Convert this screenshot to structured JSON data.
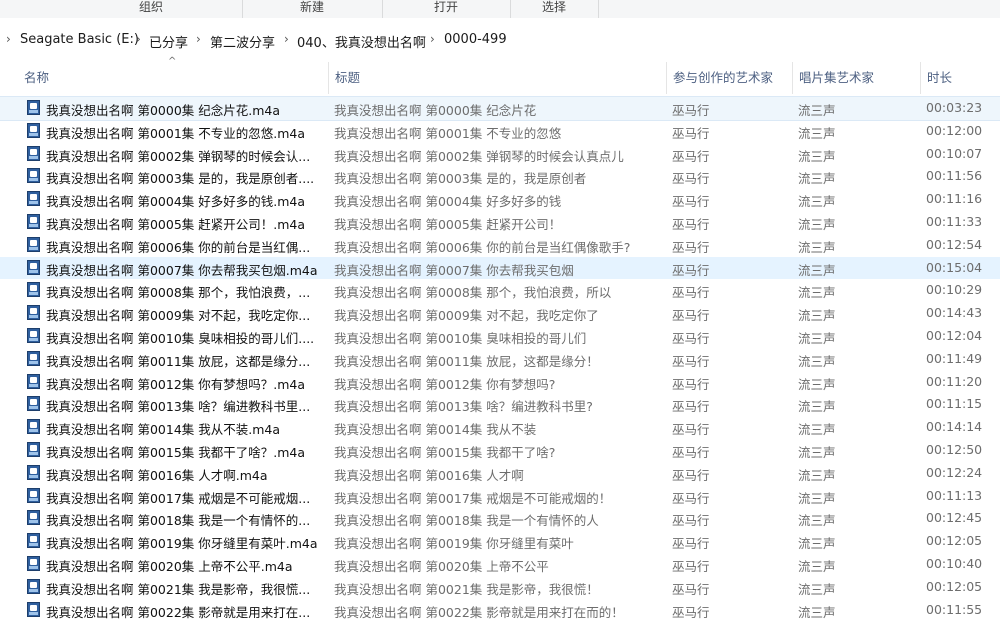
{
  "ribbon": {
    "groups": [
      "组织",
      "新建",
      "打开",
      "选择"
    ]
  },
  "breadcrumb": [
    "Seagate Basic (E:)",
    "已分享",
    "第二波分享",
    "040、我真没想出名啊",
    "0000-499"
  ],
  "columns": {
    "name": "名称",
    "title": "标题",
    "artist": "参与创作的艺术家",
    "album_artist": "唱片集艺术家",
    "duration": "时长"
  },
  "files": [
    {
      "name": "我真没想出名啊 第0000集 纪念片花.m4a",
      "title": "我真没想出名啊 第0000集 纪念片花",
      "artist": "巫马行",
      "album_artist": "流三声",
      "duration": "00:03:23"
    },
    {
      "name": "我真没想出名啊 第0001集 不专业的忽悠.m4a",
      "title": "我真没想出名啊 第0001集 不专业的忽悠",
      "artist": "巫马行",
      "album_artist": "流三声",
      "duration": "00:12:00"
    },
    {
      "name": "我真没想出名啊 第0002集 弹钢琴的时候会认...",
      "title": "我真没想出名啊 第0002集 弹钢琴的时候会认真点儿",
      "artist": "巫马行",
      "album_artist": "流三声",
      "duration": "00:10:07"
    },
    {
      "name": "我真没想出名啊 第0003集 是的，我是原创者....",
      "title": "我真没想出名啊 第0003集 是的，我是原创者",
      "artist": "巫马行",
      "album_artist": "流三声",
      "duration": "00:11:56"
    },
    {
      "name": "我真没想出名啊 第0004集 好多好多的钱.m4a",
      "title": "我真没想出名啊 第0004集 好多好多的钱",
      "artist": "巫马行",
      "album_artist": "流三声",
      "duration": "00:11:16"
    },
    {
      "name": "我真没想出名啊 第0005集 赶紧开公司！.m4a",
      "title": "我真没想出名啊 第0005集 赶紧开公司！",
      "artist": "巫马行",
      "album_artist": "流三声",
      "duration": "00:11:33"
    },
    {
      "name": "我真没想出名啊 第0006集 你的前台是当红偶...",
      "title": "我真没想出名啊 第0006集 你的前台是当红偶像歌手?",
      "artist": "巫马行",
      "album_artist": "流三声",
      "duration": "00:12:54"
    },
    {
      "name": "我真没想出名啊 第0007集 你去帮我买包烟.m4a",
      "title": "我真没想出名啊 第0007集 你去帮我买包烟",
      "artist": "巫马行",
      "album_artist": "流三声",
      "duration": "00:15:04"
    },
    {
      "name": "我真没想出名啊 第0008集 那个，我怕浪费，...",
      "title": "我真没想出名啊 第0008集 那个，我怕浪费，所以",
      "artist": "巫马行",
      "album_artist": "流三声",
      "duration": "00:10:29"
    },
    {
      "name": "我真没想出名啊 第0009集 对不起，我吃定你...",
      "title": "我真没想出名啊 第0009集 对不起，我吃定你了",
      "artist": "巫马行",
      "album_artist": "流三声",
      "duration": "00:14:43"
    },
    {
      "name": "我真没想出名啊 第0010集 臭味相投的哥儿们....",
      "title": "我真没想出名啊 第0010集 臭味相投的哥儿们",
      "artist": "巫马行",
      "album_artist": "流三声",
      "duration": "00:12:04"
    },
    {
      "name": "我真没想出名啊 第0011集 放屁，这都是缘分...",
      "title": "我真没想出名啊 第0011集 放屁，这都是缘分！",
      "artist": "巫马行",
      "album_artist": "流三声",
      "duration": "00:11:49"
    },
    {
      "name": "我真没想出名啊 第0012集 你有梦想吗？.m4a",
      "title": "我真没想出名啊 第0012集 你有梦想吗?",
      "artist": "巫马行",
      "album_artist": "流三声",
      "duration": "00:11:20"
    },
    {
      "name": "我真没想出名啊 第0013集 啥？编进教科书里...",
      "title": "我真没想出名啊 第0013集 啥？编进教科书里?",
      "artist": "巫马行",
      "album_artist": "流三声",
      "duration": "00:11:15"
    },
    {
      "name": "我真没想出名啊 第0014集 我从不装.m4a",
      "title": "我真没想出名啊 第0014集 我从不装",
      "artist": "巫马行",
      "album_artist": "流三声",
      "duration": "00:14:14"
    },
    {
      "name": "我真没想出名啊 第0015集 我都干了啥？.m4a",
      "title": "我真没想出名啊 第0015集 我都干了啥?",
      "artist": "巫马行",
      "album_artist": "流三声",
      "duration": "00:12:50"
    },
    {
      "name": "我真没想出名啊 第0016集 人才啊.m4a",
      "title": "我真没想出名啊 第0016集 人才啊",
      "artist": "巫马行",
      "album_artist": "流三声",
      "duration": "00:12:24"
    },
    {
      "name": "我真没想出名啊 第0017集 戒烟是不可能戒烟...",
      "title": "我真没想出名啊 第0017集 戒烟是不可能戒烟的！",
      "artist": "巫马行",
      "album_artist": "流三声",
      "duration": "00:11:13"
    },
    {
      "name": "我真没想出名啊 第0018集 我是一个有情怀的...",
      "title": "我真没想出名啊 第0018集 我是一个有情怀的人",
      "artist": "巫马行",
      "album_artist": "流三声",
      "duration": "00:12:45"
    },
    {
      "name": "我真没想出名啊 第0019集 你牙缝里有菜叶.m4a",
      "title": "我真没想出名啊 第0019集 你牙缝里有菜叶",
      "artist": "巫马行",
      "album_artist": "流三声",
      "duration": "00:12:05"
    },
    {
      "name": "我真没想出名啊 第0020集 上帝不公平.m4a",
      "title": "我真没想出名啊 第0020集 上帝不公平",
      "artist": "巫马行",
      "album_artist": "流三声",
      "duration": "00:10:40"
    },
    {
      "name": "我真没想出名啊 第0021集 我是影帝，我很慌...",
      "title": "我真没想出名啊 第0021集 我是影帝，我很慌！",
      "artist": "巫马行",
      "album_artist": "流三声",
      "duration": "00:12:05"
    },
    {
      "name": "我真没想出名啊 第0022集 影帝就是用来打在...",
      "title": "我真没想出名啊 第0022集 影帝就是用来打在而的！",
      "artist": "巫马行",
      "album_artist": "流三声",
      "duration": "00:11:55"
    }
  ]
}
